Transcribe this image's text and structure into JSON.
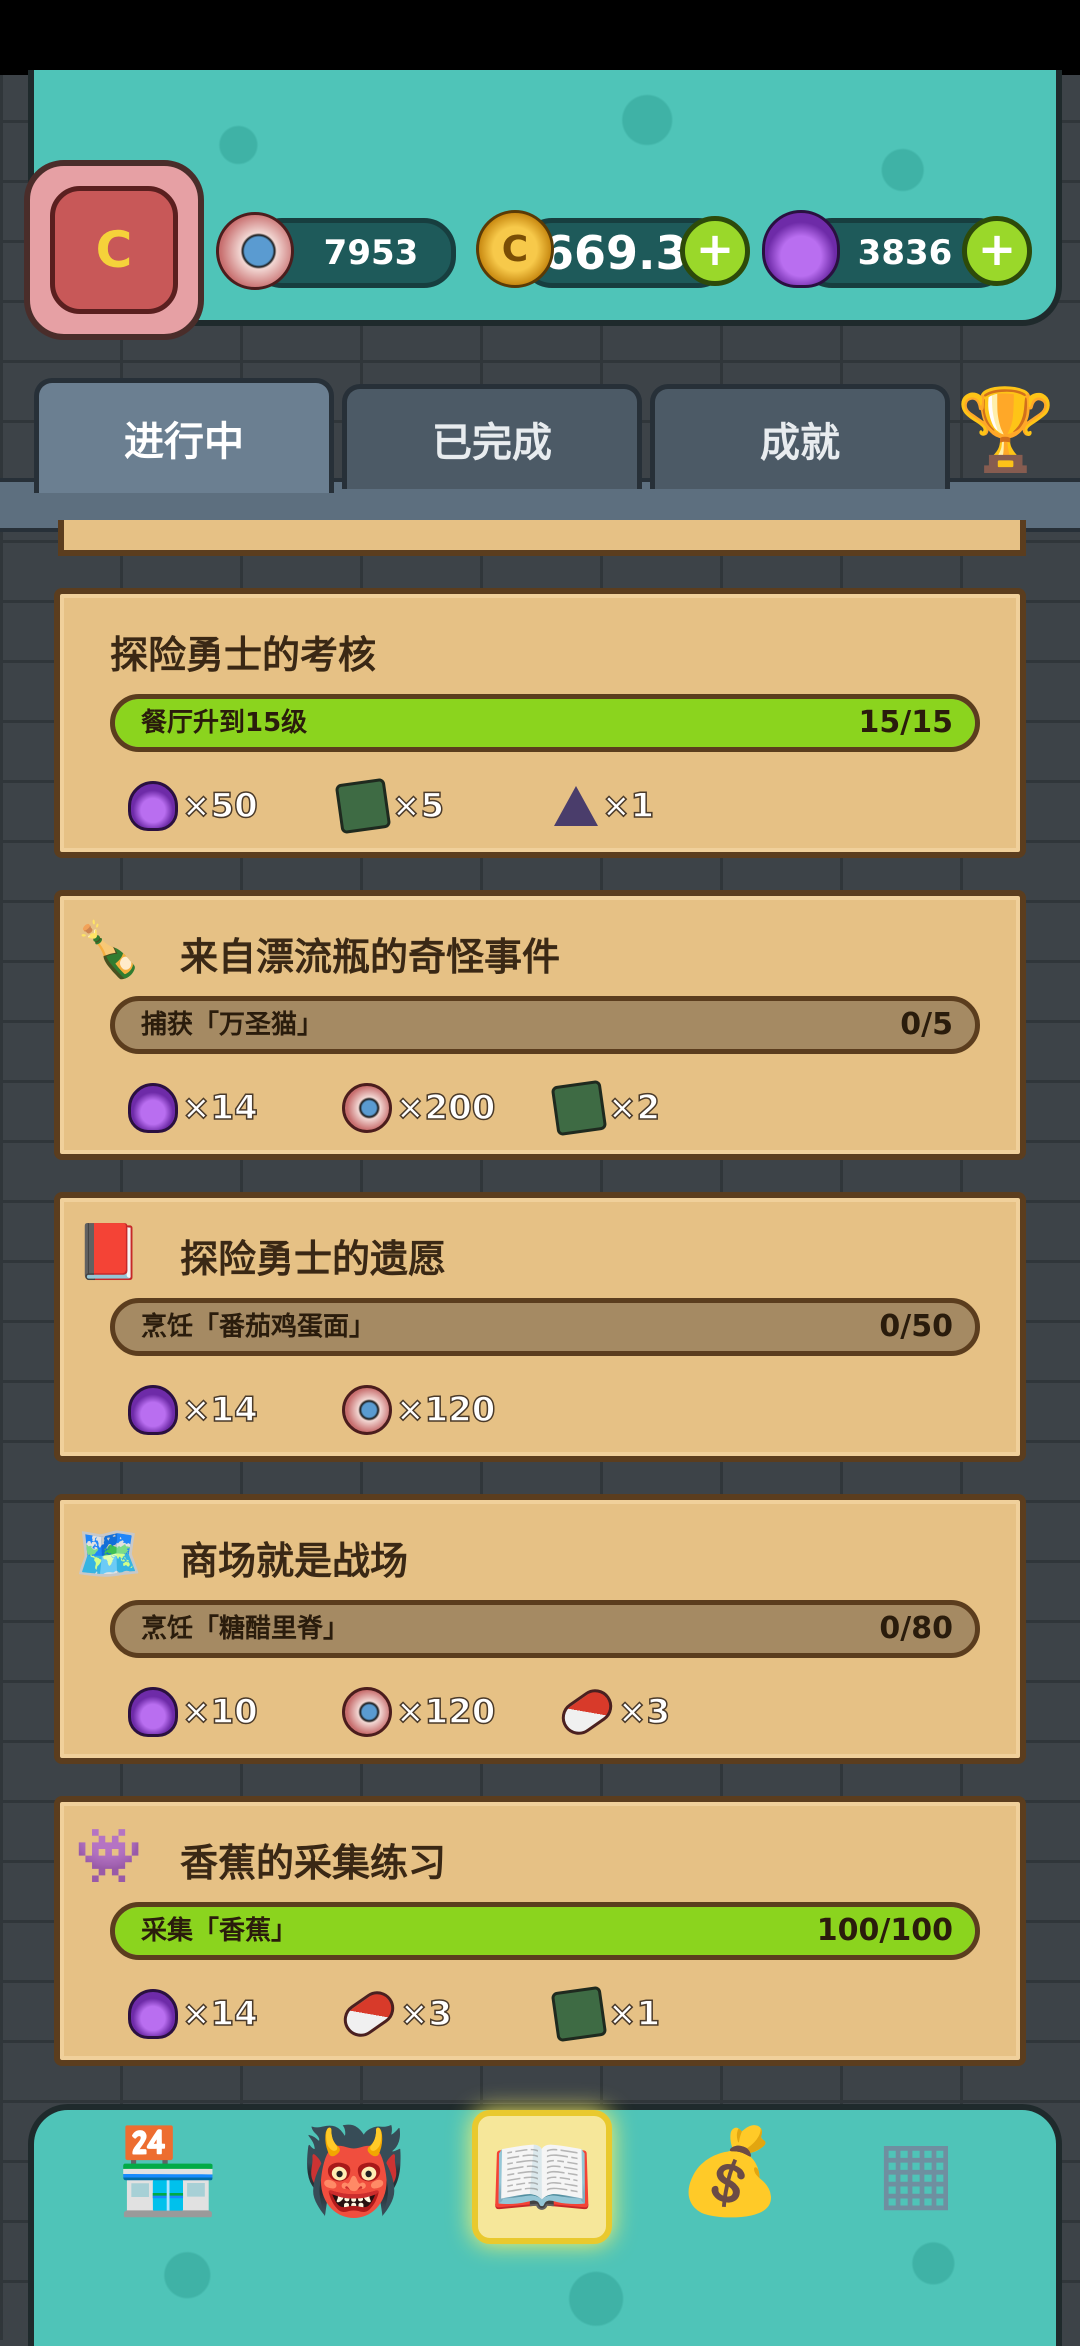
{
  "header": {
    "avatar_letter": "C",
    "eyes": "7953",
    "coins": "669.3k",
    "potions": "3836"
  },
  "tabs": [
    {
      "label": "进行中",
      "active": true
    },
    {
      "label": "已完成",
      "active": false
    },
    {
      "label": "成就",
      "active": false
    }
  ],
  "quests": [
    {
      "title": "探险勇士的考核",
      "task": "餐厅升到15级",
      "count": "15/15",
      "progress": 1.0,
      "rewards": [
        {
          "icon": "potion-icon",
          "amount": "×50"
        },
        {
          "icon": "book-icon",
          "amount": "×5"
        },
        {
          "icon": "pyramid-icon",
          "amount": "×1"
        }
      ]
    },
    {
      "title": "来自漂流瓶的奇怪事件",
      "task": "捕获「万圣猫」",
      "count": "0/5",
      "progress": 0.0,
      "rewards": [
        {
          "icon": "potion-icon",
          "amount": "×14"
        },
        {
          "icon": "eye-icon",
          "amount": "×200"
        },
        {
          "icon": "book-icon",
          "amount": "×2"
        }
      ]
    },
    {
      "title": "探险勇士的遗愿",
      "task": "烹饪「番茄鸡蛋面」",
      "count": "0/50",
      "progress": 0.0,
      "rewards": [
        {
          "icon": "potion-icon",
          "amount": "×14"
        },
        {
          "icon": "eye-icon",
          "amount": "×120"
        }
      ]
    },
    {
      "title": "商场就是战场",
      "task": "烹饪「糖醋里脊」",
      "count": "0/80",
      "progress": 0.0,
      "rewards": [
        {
          "icon": "potion-icon",
          "amount": "×10"
        },
        {
          "icon": "eye-icon",
          "amount": "×120"
        },
        {
          "icon": "pill-icon",
          "amount": "×3"
        }
      ]
    },
    {
      "title": "香蕉的采集练习",
      "task": "采集「香蕉」",
      "count": "100/100",
      "progress": 1.0,
      "rewards": [
        {
          "icon": "potion-icon",
          "amount": "×14"
        },
        {
          "icon": "pill-icon",
          "amount": "×3"
        },
        {
          "icon": "book-icon",
          "amount": "×1"
        }
      ]
    }
  ],
  "colors": {
    "teal": "#4fc4b8",
    "parchment": "#e6c185",
    "progress_green": "#8bd41e"
  }
}
